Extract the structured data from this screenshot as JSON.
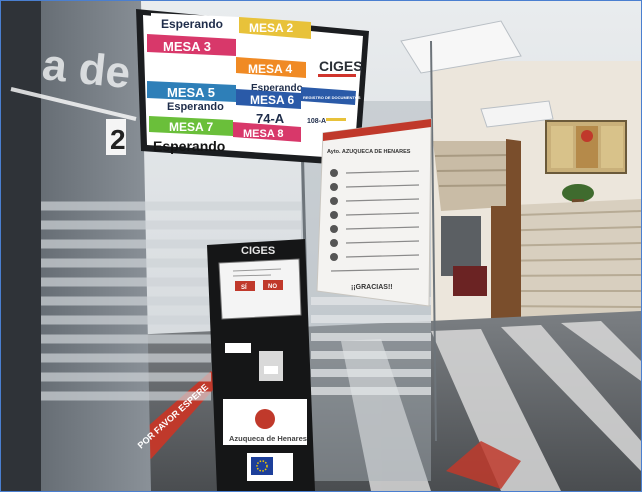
{
  "monitor": {
    "brand": "CIGES",
    "rows": [
      {
        "left": "Esperando",
        "right": "MESA 2"
      },
      {
        "left": "MESA 3",
        "right": "MESA 4"
      },
      {
        "left": "MESA 5",
        "right": "MESA 6"
      },
      {
        "left": "MESA 7",
        "right": "MESA 8"
      }
    ],
    "status_right_row2": "Esperando",
    "status_left_row3": "Esperando",
    "ticket_center": "74-A",
    "status_bottom": "Esperando",
    "side_header": "REGISTRO DE DOCUMENTOS",
    "side_ticket": "108-A"
  },
  "kiosk": {
    "brand": "CIGES",
    "button_yes": "SÍ",
    "button_no": "NO",
    "town_name": "Azuqueca de Henares"
  },
  "sign": {
    "heading": "Ayto. AZUQUECA DE HENARES",
    "closing": "¡¡GRACIAS!!"
  },
  "wall_letters": "a de",
  "pillar_number": "2",
  "floor_text": "POR FAVOR ESPERE"
}
